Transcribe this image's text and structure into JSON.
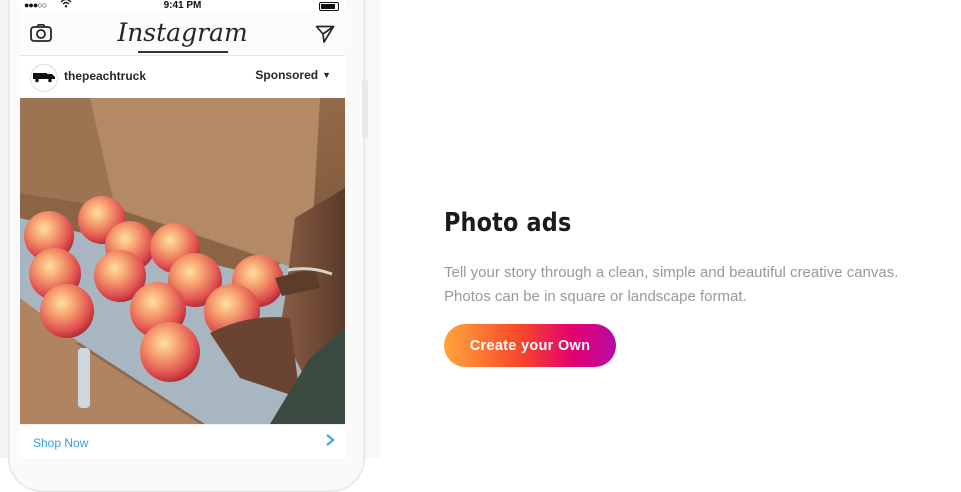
{
  "phone": {
    "status_time": "9:41 PM",
    "app_logo": "Instagram",
    "post": {
      "username": "thepeachtruck",
      "sponsored_label": "Sponsored",
      "cta_label": "Shop Now"
    }
  },
  "feature": {
    "title": "Photo ads",
    "description_line1": "Tell your story through a clean, simple and beautiful creative canvas.",
    "description_line2": "Photos can be in square or landscape format.",
    "button_label": "Create your Own"
  },
  "colors": {
    "button_gradient": [
      "#ffa53a",
      "#f7452b",
      "#e3006f",
      "#b80ba5"
    ],
    "link_blue": "#3897f0",
    "title": "#1b1b1b",
    "description": "#999999"
  },
  "icons": [
    "camera-icon",
    "send-icon",
    "chevron-down-icon",
    "chevron-right-icon",
    "truck-icon"
  ]
}
